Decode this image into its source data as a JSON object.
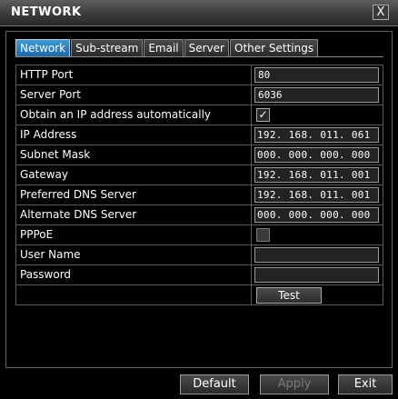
{
  "window": {
    "title": "NETWORK",
    "close_label": "X"
  },
  "tabs": [
    {
      "label": "Network",
      "active": true
    },
    {
      "label": "Sub-stream"
    },
    {
      "label": "Email"
    },
    {
      "label": "Server"
    },
    {
      "label": "Other Settings"
    }
  ],
  "rows": {
    "http_port": {
      "label": "HTTP Port",
      "value": "80"
    },
    "server_port": {
      "label": "Server Port",
      "value": "6036"
    },
    "obtain_ip": {
      "label": "Obtain an IP address automatically",
      "checked": "✓"
    },
    "ip_address": {
      "label": "IP Address",
      "value": "192. 168. 011. 061"
    },
    "subnet_mask": {
      "label": "Subnet Mask",
      "value": "000. 000. 000. 000"
    },
    "gateway": {
      "label": "Gateway",
      "value": "192. 168. 011. 001"
    },
    "preferred_dns": {
      "label": "Preferred DNS Server",
      "value": "192. 168. 011. 001"
    },
    "alternate_dns": {
      "label": "Alternate DNS Server",
      "value": "000. 000. 000. 000"
    },
    "pppoe": {
      "label": "PPPoE",
      "checked": ""
    },
    "user_name": {
      "label": "User Name",
      "value": ""
    },
    "password": {
      "label": "Password",
      "value": ""
    },
    "test": {
      "button_label": "Test"
    }
  },
  "footer": {
    "default_label": "Default",
    "apply_label": "Apply",
    "exit_label": "Exit"
  }
}
